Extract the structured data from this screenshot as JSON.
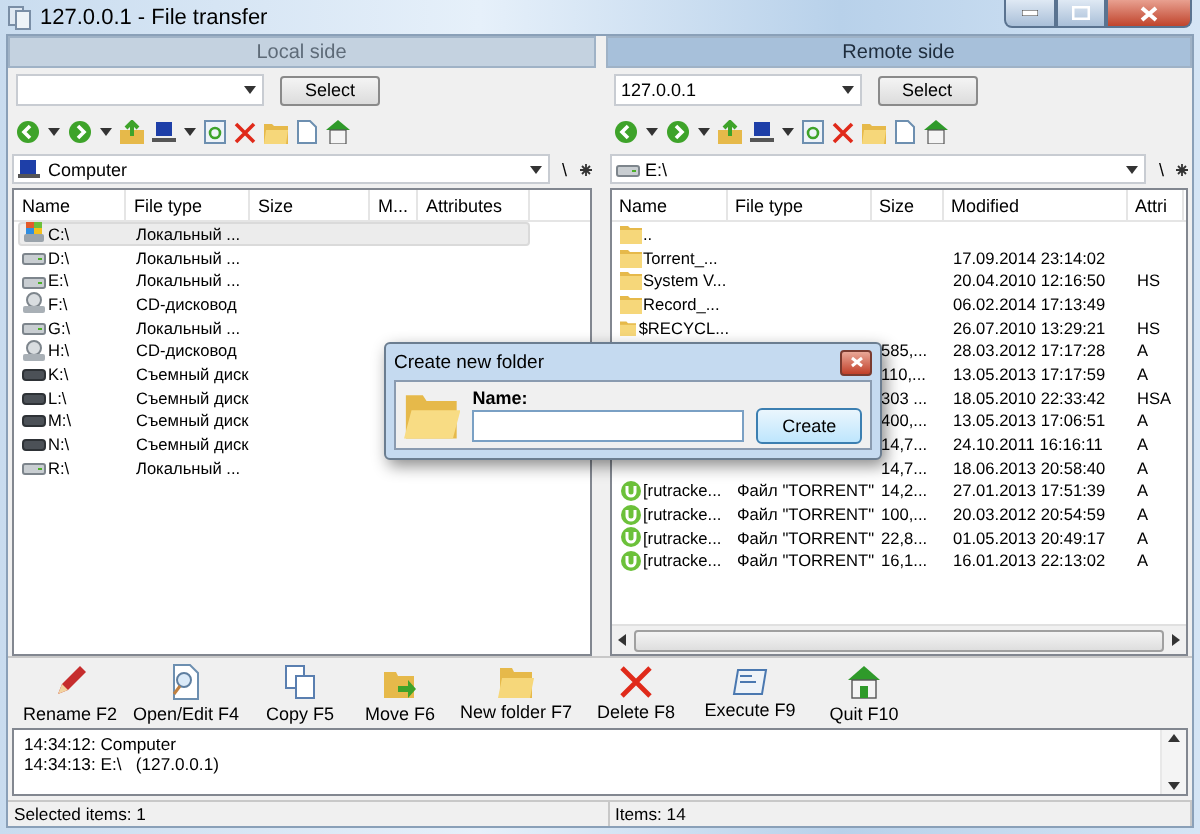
{
  "window": {
    "title": "127.0.0.1 - File transfer"
  },
  "panels": [
    {
      "title": "Local side",
      "active": false,
      "select_button": "Select",
      "path": {
        "label": "Computer",
        "kind": "computer"
      },
      "root_button": "\\",
      "horizontal_scrollbar": false,
      "columns": [
        "Name",
        "File type",
        "Size",
        "M...",
        "Attributes"
      ],
      "rows": [
        {
          "name": "C:\\",
          "type": "Локальный ...",
          "kind": "system",
          "selected": true
        },
        {
          "name": "D:\\",
          "type": "Локальный ...",
          "kind": "disk",
          "selected": false
        },
        {
          "name": "E:\\",
          "type": "Локальный ...",
          "kind": "disk",
          "selected": false
        },
        {
          "name": "F:\\",
          "type": "CD-дисковод",
          "kind": "cd",
          "selected": false
        },
        {
          "name": "G:\\",
          "type": "Локальный ...",
          "kind": "disk",
          "selected": false
        },
        {
          "name": "H:\\",
          "type": "CD-дисковод",
          "kind": "cd",
          "selected": false
        },
        {
          "name": "K:\\",
          "type": "Съемный диск",
          "kind": "removable",
          "selected": false
        },
        {
          "name": "L:\\",
          "type": "Съемный диск",
          "kind": "removable",
          "selected": false
        },
        {
          "name": "M:\\",
          "type": "Съемный диск",
          "kind": "removable",
          "selected": false
        },
        {
          "name": "N:\\",
          "type": "Съемный диск",
          "kind": "removable",
          "selected": false
        },
        {
          "name": "R:\\",
          "type": "Локальный ...",
          "kind": "disk",
          "selected": false
        }
      ]
    },
    {
      "title": "Remote side",
      "active": true,
      "host": {
        "value": "127.0.0.1"
      },
      "select_button": "Select",
      "path": {
        "label": "E:\\",
        "kind": "disk"
      },
      "root_button": "\\",
      "horizontal_scrollbar": true,
      "columns": [
        "Name",
        "File type",
        "Size",
        "Modified",
        "Attri"
      ],
      "rows": [
        {
          "name": "..",
          "kind": "folder",
          "selected": false
        },
        {
          "name": "Torrent_...",
          "modified": "17.09.2014 23:14:02",
          "kind": "folder",
          "selected": false
        },
        {
          "name": "System V...",
          "modified": "20.04.2010 12:16:50",
          "attributes": "HS",
          "kind": "folder",
          "selected": false
        },
        {
          "name": "Record_...",
          "modified": "06.02.2014 17:13:49",
          "kind": "folder",
          "selected": false
        },
        {
          "name": "$RECYCL...",
          "modified": "26.07.2010 13:29:21",
          "attributes": "HS",
          "kind": "folder",
          "selected": false
        },
        {
          "size": "585,...",
          "modified": "28.03.2012 17:17:28",
          "attributes": "A",
          "selected": false
        },
        {
          "size": "110,...",
          "modified": "13.05.2013 17:17:59",
          "attributes": "A",
          "selected": false
        },
        {
          "size": "303 ...",
          "modified": "18.05.2010 22:33:42",
          "attributes": "HSA",
          "selected": false
        },
        {
          "size": "400,...",
          "modified": "13.05.2013 17:06:51",
          "attributes": "A",
          "selected": false
        },
        {
          "size": "14,7...",
          "modified": "24.10.2011 16:16:11",
          "attributes": "A",
          "selected": false
        },
        {
          "size": "14,7...",
          "modified": "18.06.2013 20:58:40",
          "attributes": "A",
          "selected": false
        },
        {
          "name": "[rutracke...",
          "type": "Файл \"TORRENT\"",
          "size": "14,2...",
          "modified": "27.01.2013 17:51:39",
          "attributes": "A",
          "kind": "torrent",
          "selected": false
        },
        {
          "name": "[rutracke...",
          "type": "Файл \"TORRENT\"",
          "size": "100,...",
          "modified": "20.03.2012 20:54:59",
          "attributes": "A",
          "kind": "torrent",
          "selected": false
        },
        {
          "name": "[rutracke...",
          "type": "Файл \"TORRENT\"",
          "size": "22,8...",
          "modified": "01.05.2013 20:49:17",
          "attributes": "A",
          "kind": "torrent",
          "selected": false
        },
        {
          "name": "[rutracke...",
          "type": "Файл \"TORRENT\"",
          "size": "16,1...",
          "modified": "16.01.2013 22:13:02",
          "attributes": "A",
          "kind": "torrent",
          "selected": false
        }
      ]
    }
  ],
  "toolbar": [
    {
      "label": "Rename F2",
      "kind": "rename"
    },
    {
      "label": "Open/Edit F4",
      "kind": "open"
    },
    {
      "label": "Copy F5",
      "kind": "copy"
    },
    {
      "label": "Move F6",
      "kind": "move"
    },
    {
      "label": "New folder F7",
      "kind": "new_folder"
    },
    {
      "label": "Delete F8",
      "kind": "delete"
    },
    {
      "label": "Execute F9",
      "kind": "execute"
    },
    {
      "label": "Quit F10",
      "kind": "quit"
    }
  ],
  "log": [
    "14:34:12: Computer",
    "14:34:13: E:\\   (127.0.0.1)"
  ],
  "status_bar": {
    "left": "Selected items: 1",
    "right": "Items: 14"
  },
  "dialog": {
    "title": "Create new folder",
    "label": "Name:",
    "button": "Create"
  }
}
